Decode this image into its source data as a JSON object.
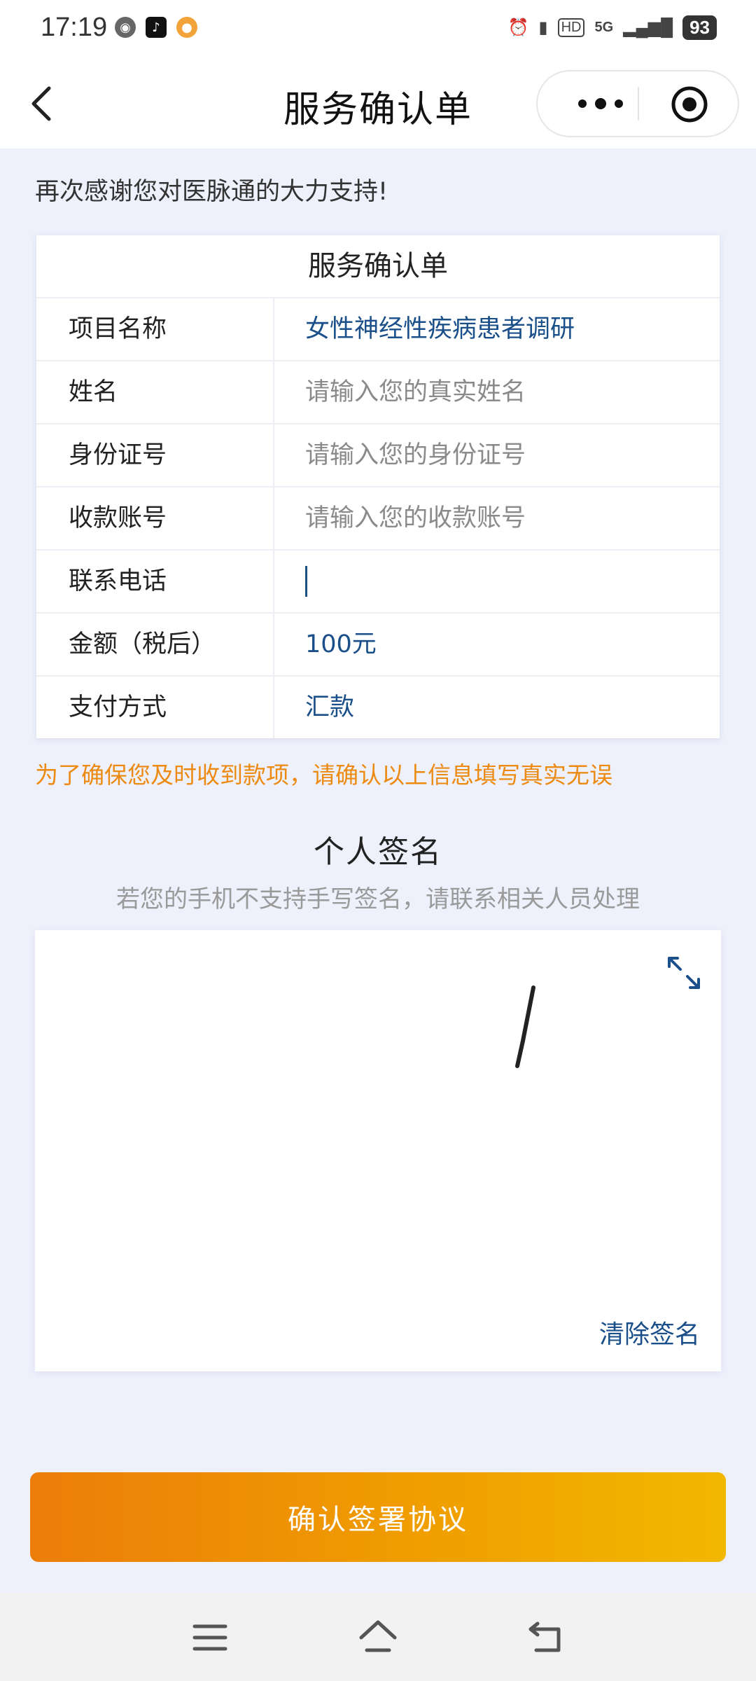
{
  "status_bar": {
    "time": "17:19",
    "network": "5G",
    "hd": "HD",
    "battery": "93"
  },
  "navbar": {
    "title": "服务确认单"
  },
  "page": {
    "thanks": "再次感谢您对医脉通的大力支持!",
    "form_title": "服务确认单",
    "rows": [
      {
        "label": "项目名称",
        "value": "女性神经性疾病患者调研"
      },
      {
        "label": "姓名",
        "placeholder": "请输入您的真实姓名"
      },
      {
        "label": "身份证号",
        "placeholder": "请输入您的身份证号"
      },
      {
        "label": "收款账号",
        "placeholder": "请输入您的收款账号"
      },
      {
        "label": "联系电话",
        "value": ""
      },
      {
        "label": "金额（税后）",
        "value": "100元"
      },
      {
        "label": "支付方式",
        "value": "汇款"
      }
    ],
    "warning": "为了确保您及时收到款项，请确认以上信息填写真实无误",
    "signature": {
      "title": "个人签名",
      "subtitle": "若您的手机不支持手写签名，请联系相关人员处理",
      "clear_label": "清除签名"
    },
    "confirm_label": "确认签署协议"
  },
  "colors": {
    "accent_blue": "#1a4f8a",
    "warning_orange": "#ec8a12",
    "button_gradient_start": "#ec7d0a",
    "button_gradient_end": "#f2b800",
    "background": "#eef0fb"
  }
}
